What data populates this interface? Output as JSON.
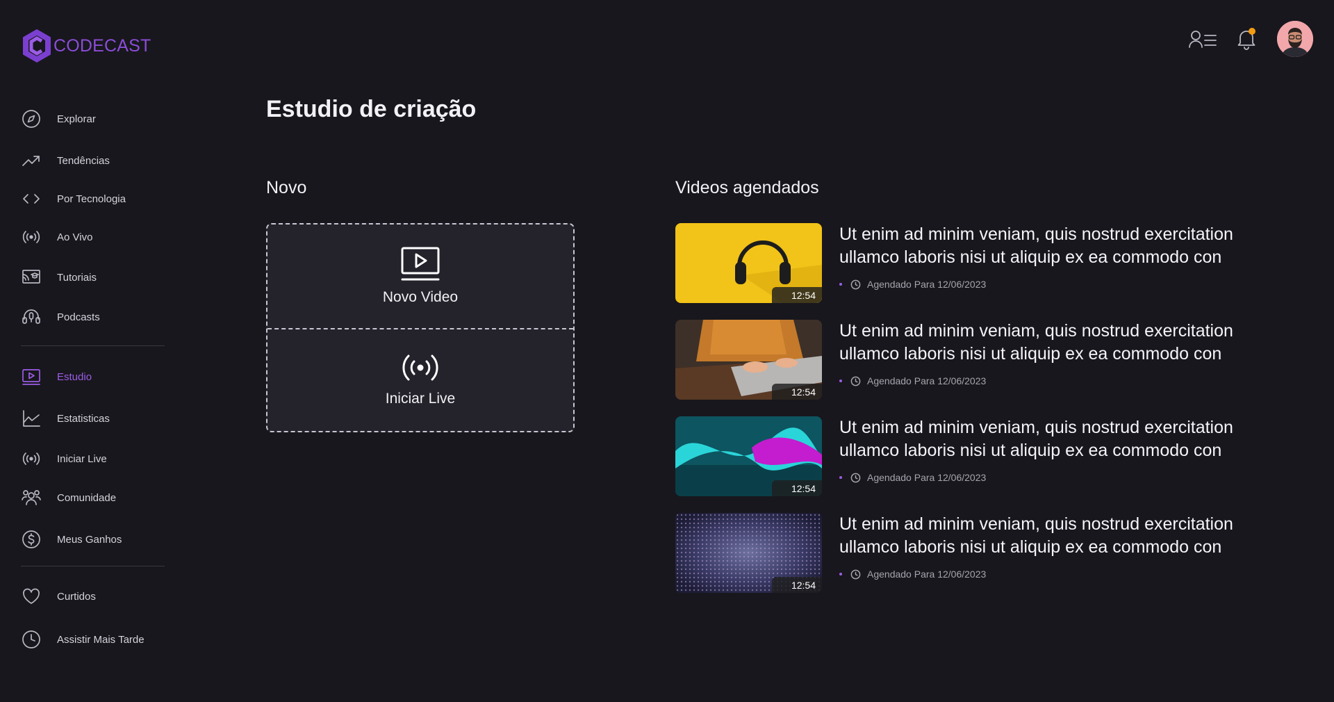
{
  "app": {
    "name": "CODECAST",
    "brand_color": "#8b4dd8"
  },
  "sidebar": {
    "primary": [
      {
        "label": "Explorar",
        "icon": "compass-icon"
      },
      {
        "label": "Tendências",
        "icon": "trending-icon"
      },
      {
        "label": "Por Tecnologia",
        "icon": "code-icon"
      },
      {
        "label": "Ao Vivo",
        "icon": "broadcast-icon"
      },
      {
        "label": "Tutoriais",
        "icon": "tutorial-icon"
      },
      {
        "label": "Podcasts",
        "icon": "podcast-icon"
      }
    ],
    "studio": [
      {
        "label": "Estudio",
        "icon": "video-icon",
        "active": true
      },
      {
        "label": "Estatisticas",
        "icon": "chart-icon"
      },
      {
        "label": "Iniciar Live",
        "icon": "broadcast-icon"
      },
      {
        "label": "Comunidade",
        "icon": "community-icon"
      },
      {
        "label": "Meus Ganhos",
        "icon": "dollar-icon"
      }
    ],
    "library": [
      {
        "label": "Curtidos",
        "icon": "heart-icon"
      },
      {
        "label": "Assistir Mais Tarde",
        "icon": "clock-icon"
      }
    ]
  },
  "header": {
    "icons": [
      "profile-list-icon",
      "bell-icon",
      "avatar"
    ],
    "notification_color": "#f39c12"
  },
  "main": {
    "title": "Estudio de criação",
    "new_section": {
      "title": "Novo",
      "actions": [
        {
          "label": "Novo Video",
          "icon": "video-icon"
        },
        {
          "label": "Iniciar Live",
          "icon": "broadcast-icon"
        }
      ]
    },
    "scheduled_section": {
      "title": "Videos agendados",
      "videos": [
        {
          "title": "Ut enim ad minim veniam, quis nostrud exercitation ullamco laboris nisi ut aliquip ex ea commodo con",
          "duration": "12:54",
          "scheduled": "Agendado Para 12/06/2023",
          "thumbnail": "headphones-yellow"
        },
        {
          "title": "Ut enim ad minim veniam, quis nostrud exercitation ullamco laboris nisi ut aliquip ex ea commodo con",
          "duration": "12:54",
          "scheduled": "Agendado Para 12/06/2023",
          "thumbnail": "laptop-typing"
        },
        {
          "title": "Ut enim ad minim veniam, quis nostrud exercitation ullamco laboris nisi ut aliquip ex ea commodo con",
          "duration": "12:54",
          "scheduled": "Agendado Para 12/06/2023",
          "thumbnail": "abstract-wave"
        },
        {
          "title": "Ut enim ad minim veniam, quis nostrud exercitation ullamco laboris nisi ut aliquip ex ea commodo con",
          "duration": "12:54",
          "scheduled": "Agendado Para 12/06/2023",
          "thumbnail": "abstract-particles"
        }
      ]
    }
  }
}
